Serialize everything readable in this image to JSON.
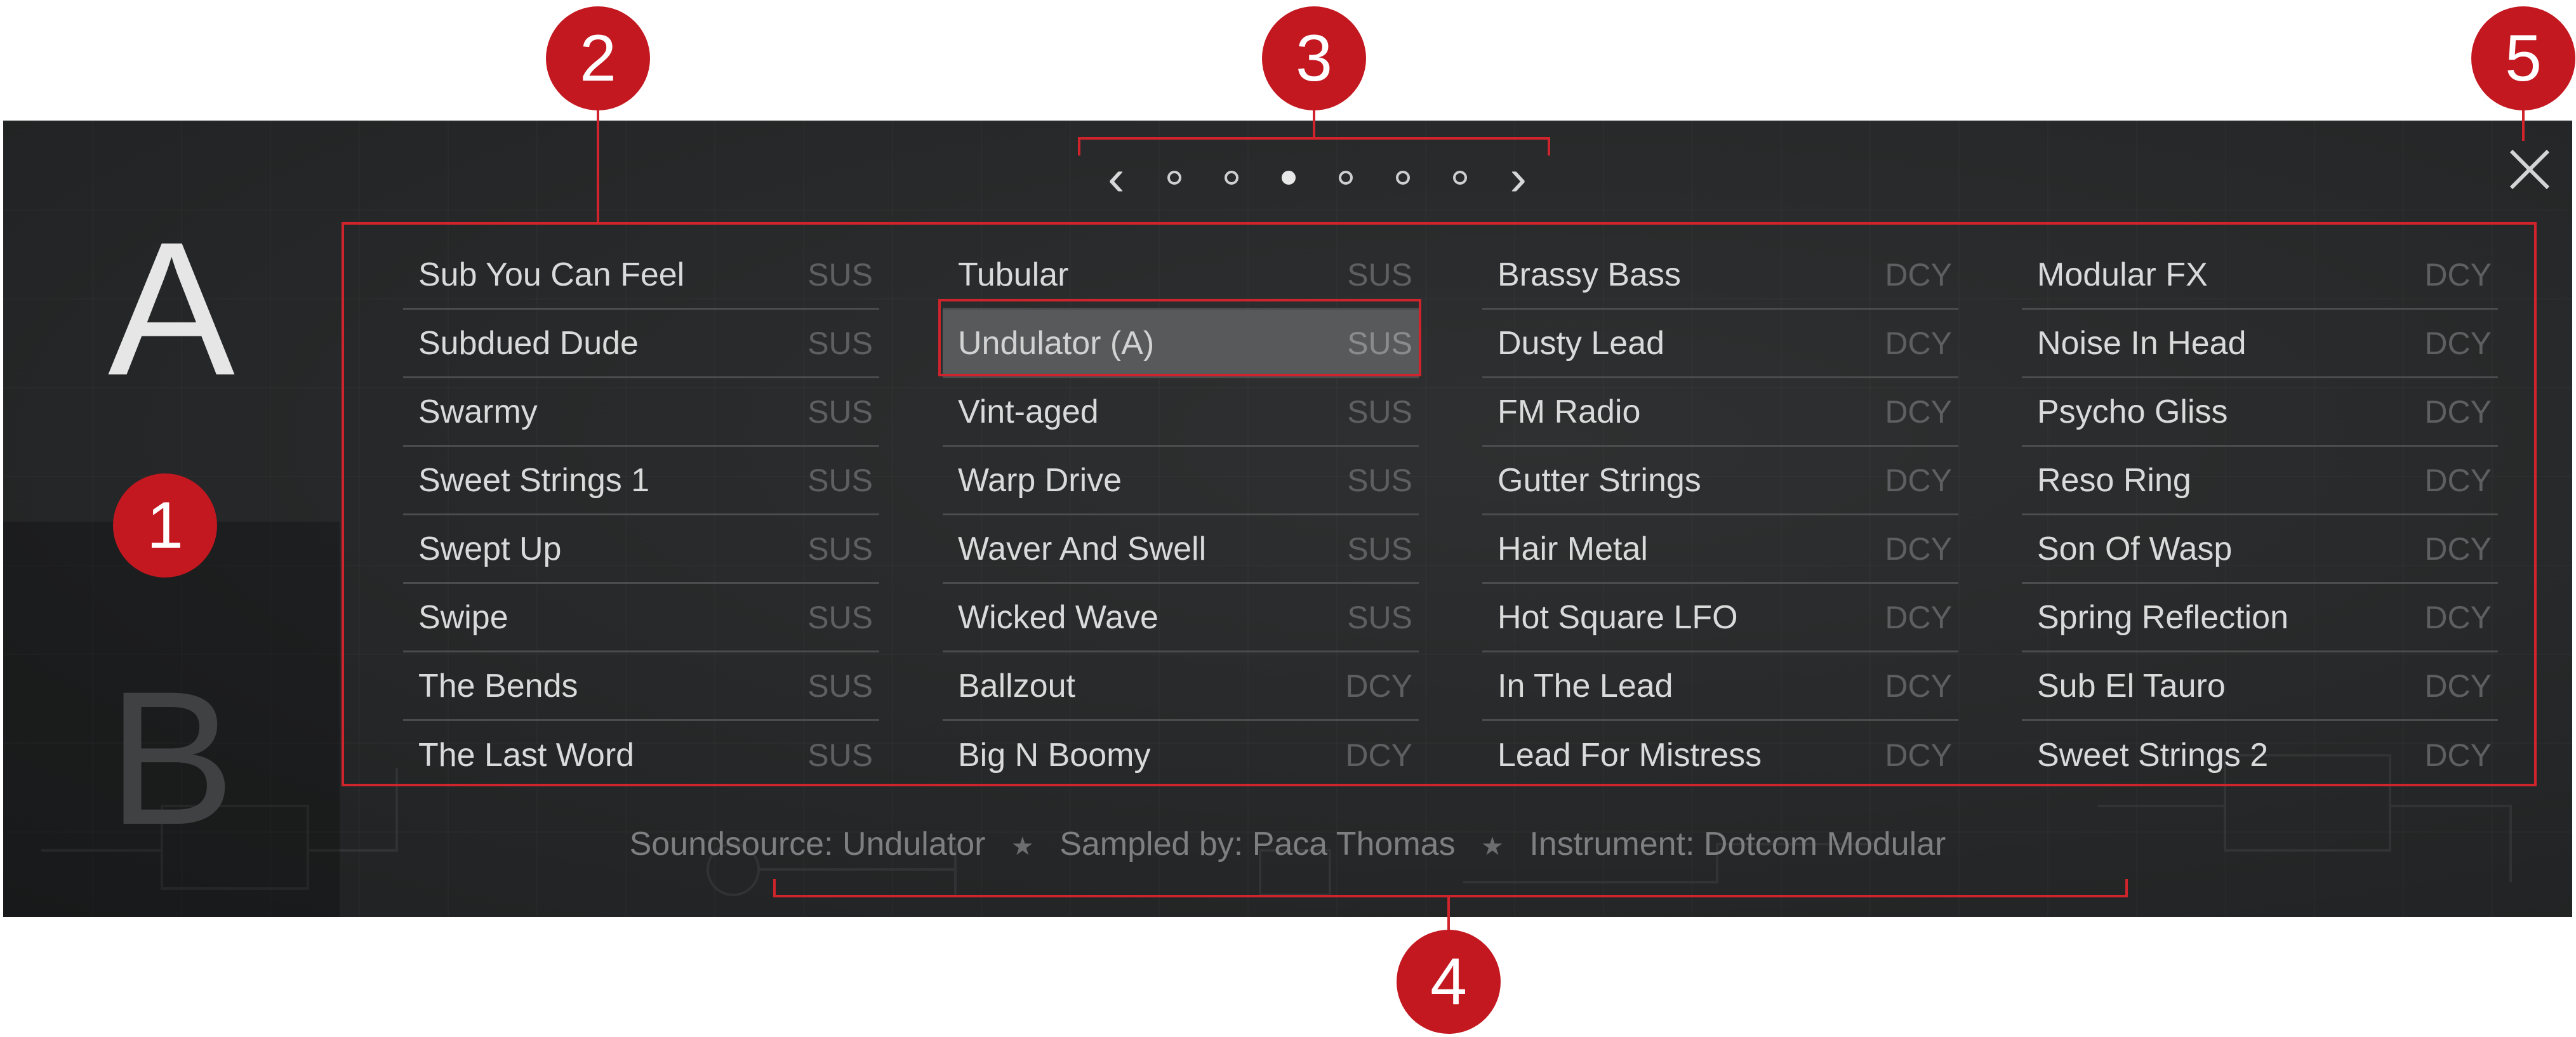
{
  "slots": {
    "a": "A",
    "b": "B"
  },
  "pager": {
    "prev_icon": "chevron-left-icon",
    "next_icon": "chevron-right-icon",
    "page_count": 6,
    "active_page": 3
  },
  "close_icon": "close-icon",
  "columns": [
    [
      {
        "name": "Sub You Can Feel",
        "tag": "SUS"
      },
      {
        "name": "Subdued Dude",
        "tag": "SUS"
      },
      {
        "name": "Swarmy",
        "tag": "SUS"
      },
      {
        "name": "Sweet Strings 1",
        "tag": "SUS"
      },
      {
        "name": "Swept Up",
        "tag": "SUS"
      },
      {
        "name": "Swipe",
        "tag": "SUS"
      },
      {
        "name": "The Bends",
        "tag": "SUS"
      },
      {
        "name": "The Last Word",
        "tag": "SUS"
      }
    ],
    [
      {
        "name": "Tubular",
        "tag": "SUS"
      },
      {
        "name": "Undulator (A)",
        "tag": "SUS"
      },
      {
        "name": "Vint-aged",
        "tag": "SUS"
      },
      {
        "name": "Warp Drive",
        "tag": "SUS"
      },
      {
        "name": "Waver And Swell",
        "tag": "SUS"
      },
      {
        "name": "Wicked Wave",
        "tag": "SUS"
      },
      {
        "name": "Ballzout",
        "tag": "DCY"
      },
      {
        "name": "Big N Boomy",
        "tag": "DCY"
      }
    ],
    [
      {
        "name": "Brassy Bass",
        "tag": "DCY"
      },
      {
        "name": "Dusty Lead",
        "tag": "DCY"
      },
      {
        "name": "FM Radio",
        "tag": "DCY"
      },
      {
        "name": "Gutter Strings",
        "tag": "DCY"
      },
      {
        "name": "Hair Metal",
        "tag": "DCY"
      },
      {
        "name": "Hot Square LFO",
        "tag": "DCY"
      },
      {
        "name": "In The Lead",
        "tag": "DCY"
      },
      {
        "name": "Lead For Mistress",
        "tag": "DCY"
      }
    ],
    [
      {
        "name": "Modular FX",
        "tag": "DCY"
      },
      {
        "name": "Noise In Head",
        "tag": "DCY"
      },
      {
        "name": "Psycho Gliss",
        "tag": "DCY"
      },
      {
        "name": "Reso Ring",
        "tag": "DCY"
      },
      {
        "name": "Son Of Wasp",
        "tag": "DCY"
      },
      {
        "name": "Spring Reflection",
        "tag": "DCY"
      },
      {
        "name": "Sub El Tauro",
        "tag": "DCY"
      },
      {
        "name": "Sweet Strings 2",
        "tag": "DCY"
      }
    ]
  ],
  "selected": {
    "column": 1,
    "row": 1
  },
  "info": {
    "soundsource": "Soundsource: Undulator",
    "sampled_by": "Sampled by: Paca Thomas",
    "instrument": "Instrument: Dotcom Modular",
    "separator": "★"
  },
  "callouts": [
    "1",
    "2",
    "3",
    "4",
    "5"
  ],
  "colors": {
    "panel_bg": "#262829",
    "callout_red": "#c41820",
    "highlight_outline": "#d0242c",
    "selected_row_bg": "#58595a",
    "text_primary": "#dadada",
    "text_tag": "#5d5f60"
  }
}
